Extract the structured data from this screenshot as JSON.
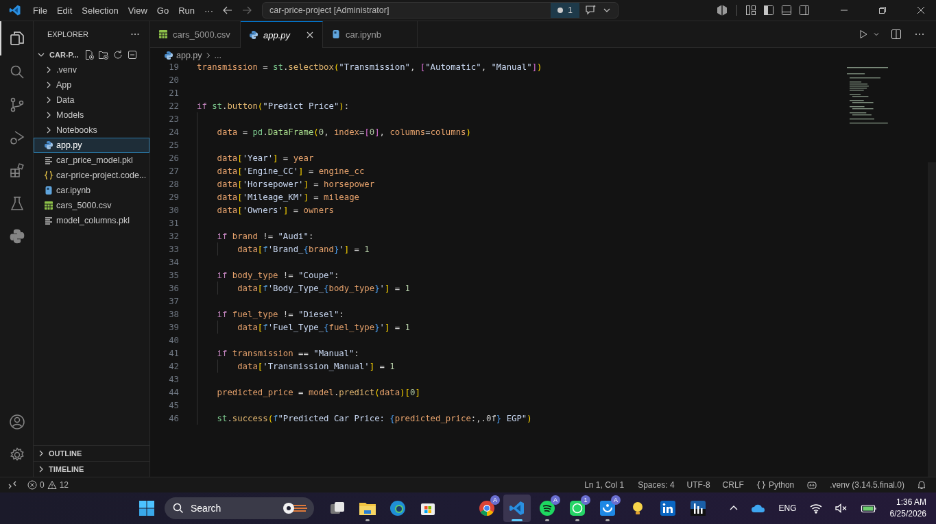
{
  "titlebar": {
    "menu": [
      "File",
      "Edit",
      "Selection",
      "View",
      "Go",
      "Run",
      "···"
    ],
    "command_center": "car-price-project [Administrator]",
    "badge": "1"
  },
  "activity_bar": {
    "items": [
      {
        "kind": "files",
        "selected": true
      },
      {
        "kind": "search",
        "selected": false
      },
      {
        "kind": "source-control",
        "selected": false
      },
      {
        "kind": "run-debug",
        "selected": false
      },
      {
        "kind": "extensions",
        "selected": false
      },
      {
        "kind": "testing",
        "selected": false
      },
      {
        "kind": "python",
        "selected": false
      }
    ]
  },
  "sidebar": {
    "title": "EXPLORER",
    "root": "CAR-P...",
    "expanded": true,
    "items": [
      {
        "label": ".venv",
        "kind": "folder",
        "selected": false
      },
      {
        "label": "App",
        "kind": "folder",
        "selected": false
      },
      {
        "label": "Data",
        "kind": "folder",
        "selected": false
      },
      {
        "label": "Models",
        "kind": "folder",
        "selected": false
      },
      {
        "label": "Notebooks",
        "kind": "folder",
        "selected": false
      },
      {
        "label": "app.py",
        "kind": "python",
        "selected": true
      },
      {
        "label": "car_price_model.pkl",
        "kind": "lines",
        "selected": false
      },
      {
        "label": "car-price-project.code...",
        "kind": "braces",
        "selected": false
      },
      {
        "label": "car.ipynb",
        "kind": "notebook",
        "selected": false
      },
      {
        "label": "cars_5000.csv",
        "kind": "csv",
        "selected": false
      },
      {
        "label": "model_columns.pkl",
        "kind": "lines",
        "selected": false
      }
    ],
    "sections": [
      {
        "label": "OUTLINE",
        "expanded": false
      },
      {
        "label": "TIMELINE",
        "expanded": false
      }
    ]
  },
  "tabs": [
    {
      "label": "cars_5000.csv",
      "kind": "csv",
      "selected": false
    },
    {
      "label": "app.py",
      "kind": "python",
      "selected": true
    },
    {
      "label": "car.ipynb",
      "kind": "notebook",
      "selected": false
    }
  ],
  "breadcrumb": [
    "app.py",
    "..."
  ],
  "editor": {
    "lines": [
      {
        "number": "19",
        "tokens": [
          {
            "kind": "var",
            "text": "transmission"
          },
          {
            "kind": "op",
            "text": " = "
          },
          {
            "kind": "mod",
            "text": "st"
          },
          {
            "kind": "op",
            "text": "."
          },
          {
            "kind": "fn",
            "text": "selectbox"
          },
          {
            "kind": "b1",
            "text": "("
          },
          {
            "kind": "str",
            "text": "\"Transmission\""
          },
          {
            "kind": "op",
            "text": ", "
          },
          {
            "kind": "b2",
            "text": "["
          },
          {
            "kind": "str",
            "text": "\"Automatic\""
          },
          {
            "kind": "op",
            "text": ", "
          },
          {
            "kind": "str",
            "text": "\"Manual\""
          },
          {
            "kind": "b2",
            "text": "]"
          },
          {
            "kind": "b1",
            "text": ")"
          }
        ]
      },
      {
        "number": "20"
      },
      {
        "number": "21"
      },
      {
        "number": "22",
        "tokens": [
          {
            "kind": "kw",
            "text": "if"
          },
          {
            "kind": "mod",
            "text": "st"
          },
          {
            "kind": "op",
            "text": "."
          },
          {
            "kind": "fn",
            "text": "button"
          },
          {
            "kind": "b1",
            "text": "("
          },
          {
            "kind": "str",
            "text": "\"Predict Price\""
          },
          {
            "kind": "b1",
            "text": ")"
          },
          {
            "kind": "op",
            "text": ":"
          }
        ],
        "children": [
          {
            "number": "23"
          },
          {
            "number": "24",
            "tokens": [
              {
                "kind": "var",
                "text": "data"
              },
              {
                "kind": "op",
                "text": " = "
              },
              {
                "kind": "mod",
                "text": "pd"
              },
              {
                "kind": "op",
                "text": "."
              },
              {
                "kind": "cls",
                "text": "DataFrame"
              },
              {
                "kind": "b1",
                "text": "("
              },
              {
                "kind": "num",
                "text": "0"
              },
              {
                "kind": "op",
                "text": ", "
              },
              {
                "kind": "var",
                "text": "index"
              },
              {
                "kind": "op",
                "text": "="
              },
              {
                "kind": "b2",
                "text": "["
              },
              {
                "kind": "num",
                "text": "0"
              },
              {
                "kind": "b2",
                "text": "]"
              },
              {
                "kind": "op",
                "text": ", "
              },
              {
                "kind": "var",
                "text": "columns"
              },
              {
                "kind": "op",
                "text": "="
              },
              {
                "kind": "var",
                "text": "columns"
              },
              {
                "kind": "b1",
                "text": ")"
              }
            ]
          },
          {
            "number": "25"
          },
          {
            "number": "26",
            "tokens": [
              {
                "kind": "var",
                "text": "data"
              },
              {
                "kind": "b1",
                "text": "["
              },
              {
                "kind": "str",
                "text": "'Year'"
              },
              {
                "kind": "b1",
                "text": "]"
              },
              {
                "kind": "op",
                "text": " = "
              },
              {
                "kind": "var",
                "text": "year"
              }
            ]
          },
          {
            "number": "27",
            "tokens": [
              {
                "kind": "var",
                "text": "data"
              },
              {
                "kind": "b1",
                "text": "["
              },
              {
                "kind": "str",
                "text": "'Engine_CC'"
              },
              {
                "kind": "b1",
                "text": "]"
              },
              {
                "kind": "op",
                "text": " = "
              },
              {
                "kind": "var",
                "text": "engine_cc"
              }
            ]
          },
          {
            "number": "28",
            "tokens": [
              {
                "kind": "var",
                "text": "data"
              },
              {
                "kind": "b1",
                "text": "["
              },
              {
                "kind": "str",
                "text": "'Horsepower'"
              },
              {
                "kind": "b1",
                "text": "]"
              },
              {
                "kind": "op",
                "text": " = "
              },
              {
                "kind": "var",
                "text": "horsepower"
              }
            ]
          },
          {
            "number": "29",
            "tokens": [
              {
                "kind": "var",
                "text": "data"
              },
              {
                "kind": "b1",
                "text": "["
              },
              {
                "kind": "str",
                "text": "'Mileage_KM'"
              },
              {
                "kind": "b1",
                "text": "]"
              },
              {
                "kind": "op",
                "text": " = "
              },
              {
                "kind": "var",
                "text": "mileage"
              }
            ]
          },
          {
            "number": "30",
            "tokens": [
              {
                "kind": "var",
                "text": "data"
              },
              {
                "kind": "b1",
                "text": "["
              },
              {
                "kind": "str",
                "text": "'Owners'"
              },
              {
                "kind": "b1",
                "text": "]"
              },
              {
                "kind": "op",
                "text": " = "
              },
              {
                "kind": "var",
                "text": "owners"
              }
            ]
          },
          {
            "number": "31"
          },
          {
            "number": "32",
            "tokens": [
              {
                "kind": "kw",
                "text": "if"
              },
              {
                "kind": "var",
                "text": "brand"
              },
              {
                "kind": "op",
                "text": " != "
              },
              {
                "kind": "str",
                "text": "\"Audi\""
              },
              {
                "kind": "op",
                "text": ":"
              }
            ],
            "children": [
              {
                "number": "33",
                "tokens": [
                  {
                    "kind": "var",
                    "text": "data"
                  },
                  {
                    "kind": "b1",
                    "text": "["
                  },
                  {
                    "kind": "pre",
                    "text": "f"
                  },
                  {
                    "kind": "str",
                    "text": "'Brand_"
                  },
                  {
                    "kind": "b3",
                    "text": "{"
                  },
                  {
                    "kind": "var",
                    "text": "brand"
                  },
                  {
                    "kind": "b3",
                    "text": "}"
                  },
                  {
                    "kind": "str",
                    "text": "'"
                  },
                  {
                    "kind": "b1",
                    "text": "]"
                  },
                  {
                    "kind": "op",
                    "text": " = "
                  },
                  {
                    "kind": "num",
                    "text": "1"
                  }
                ]
              }
            ]
          },
          {
            "number": "34"
          },
          {
            "number": "35",
            "tokens": [
              {
                "kind": "kw",
                "text": "if"
              },
              {
                "kind": "var",
                "text": "body_type"
              },
              {
                "kind": "op",
                "text": " != "
              },
              {
                "kind": "str",
                "text": "\"Coupe\""
              },
              {
                "kind": "op",
                "text": ":"
              }
            ],
            "children": [
              {
                "number": "36",
                "tokens": [
                  {
                    "kind": "var",
                    "text": "data"
                  },
                  {
                    "kind": "b1",
                    "text": "["
                  },
                  {
                    "kind": "pre",
                    "text": "f"
                  },
                  {
                    "kind": "str",
                    "text": "'Body_Type_"
                  },
                  {
                    "kind": "b3",
                    "text": "{"
                  },
                  {
                    "kind": "var",
                    "text": "body_type"
                  },
                  {
                    "kind": "b3",
                    "text": "}"
                  },
                  {
                    "kind": "str",
                    "text": "'"
                  },
                  {
                    "kind": "b1",
                    "text": "]"
                  },
                  {
                    "kind": "op",
                    "text": " = "
                  },
                  {
                    "kind": "num",
                    "text": "1"
                  }
                ]
              }
            ]
          },
          {
            "number": "37"
          },
          {
            "number": "38",
            "tokens": [
              {
                "kind": "kw",
                "text": "if"
              },
              {
                "kind": "var",
                "text": "fuel_type"
              },
              {
                "kind": "op",
                "text": " != "
              },
              {
                "kind": "str",
                "text": "\"Diesel\""
              },
              {
                "kind": "op",
                "text": ":"
              }
            ],
            "children": [
              {
                "number": "39",
                "tokens": [
                  {
                    "kind": "var",
                    "text": "data"
                  },
                  {
                    "kind": "b1",
                    "text": "["
                  },
                  {
                    "kind": "pre",
                    "text": "f"
                  },
                  {
                    "kind": "str",
                    "text": "'Fuel_Type_"
                  },
                  {
                    "kind": "b3",
                    "text": "{"
                  },
                  {
                    "kind": "var",
                    "text": "fuel_type"
                  },
                  {
                    "kind": "b3",
                    "text": "}"
                  },
                  {
                    "kind": "str",
                    "text": "'"
                  },
                  {
                    "kind": "b1",
                    "text": "]"
                  },
                  {
                    "kind": "op",
                    "text": " = "
                  },
                  {
                    "kind": "num",
                    "text": "1"
                  }
                ]
              }
            ]
          },
          {
            "number": "40"
          },
          {
            "number": "41",
            "tokens": [
              {
                "kind": "kw",
                "text": "if"
              },
              {
                "kind": "var",
                "text": "transmission"
              },
              {
                "kind": "op",
                "text": " == "
              },
              {
                "kind": "str",
                "text": "\"Manual\""
              },
              {
                "kind": "op",
                "text": ":"
              }
            ],
            "children": [
              {
                "number": "42",
                "tokens": [
                  {
                    "kind": "var",
                    "text": "data"
                  },
                  {
                    "kind": "b1",
                    "text": "["
                  },
                  {
                    "kind": "str",
                    "text": "'Transmission_Manual'"
                  },
                  {
                    "kind": "b1",
                    "text": "]"
                  },
                  {
                    "kind": "op",
                    "text": " = "
                  },
                  {
                    "kind": "num",
                    "text": "1"
                  }
                ]
              }
            ]
          },
          {
            "number": "43"
          },
          {
            "number": "44",
            "tokens": [
              {
                "kind": "var",
                "text": "predicted_price"
              },
              {
                "kind": "op",
                "text": " = "
              },
              {
                "kind": "var",
                "text": "model"
              },
              {
                "kind": "op",
                "text": "."
              },
              {
                "kind": "fn",
                "text": "predict"
              },
              {
                "kind": "b1",
                "text": "("
              },
              {
                "kind": "var",
                "text": "data"
              },
              {
                "kind": "b1",
                "text": ")"
              },
              {
                "kind": "b1",
                "text": "["
              },
              {
                "kind": "num",
                "text": "0"
              },
              {
                "kind": "b1",
                "text": "]"
              }
            ]
          },
          {
            "number": "45"
          },
          {
            "number": "46",
            "tokens": [
              {
                "kind": "mod",
                "text": "st"
              },
              {
                "kind": "op",
                "text": "."
              },
              {
                "kind": "fn",
                "text": "success"
              },
              {
                "kind": "b1",
                "text": "("
              },
              {
                "kind": "pre",
                "text": "f"
              },
              {
                "kind": "str",
                "text": "\"Predicted Car Price: "
              },
              {
                "kind": "b3",
                "text": "{"
              },
              {
                "kind": "var",
                "text": "predicted_price"
              },
              {
                "kind": "op",
                "text": ":,.0f"
              },
              {
                "kind": "b3",
                "text": "}"
              },
              {
                "kind": "str",
                "text": " EGP\""
              },
              {
                "kind": "b1",
                "text": ")"
              }
            ]
          }
        ]
      }
    ]
  },
  "status_bar": {
    "errors": "0",
    "warnings": "12",
    "items": [
      "Ln 1, Col 1",
      "Spaces: 4",
      "UTF-8",
      "CRLF"
    ],
    "language": "Python",
    "interpreter": ".venv (3.14.5.final.0)"
  },
  "taskbar": {
    "search": "Search",
    "apps": [
      {
        "kind": "task-view",
        "running": false,
        "selected": false
      },
      {
        "kind": "files",
        "running": true,
        "selected": false
      },
      {
        "kind": "edge",
        "running": false,
        "selected": false
      },
      {
        "kind": "store",
        "running": false,
        "selected": false
      },
      {
        "kind": "chrome",
        "running": false,
        "selected": false,
        "badge": "A"
      },
      {
        "kind": "vscode",
        "running": true,
        "selected": true
      },
      {
        "kind": "spotify",
        "running": true,
        "selected": false,
        "badge": "A"
      },
      {
        "kind": "whatsapp",
        "running": true,
        "selected": false,
        "badge": "1"
      },
      {
        "kind": "blue-app",
        "running": true,
        "selected": false,
        "badge": "A"
      },
      {
        "kind": "bulb",
        "running": false,
        "selected": false
      },
      {
        "kind": "linkedin",
        "running": false,
        "selected": false
      },
      {
        "kind": "chart-app",
        "running": false,
        "selected": false
      }
    ],
    "language": "ENG",
    "time": "1:36 AM",
    "date": "6/25/2026"
  }
}
